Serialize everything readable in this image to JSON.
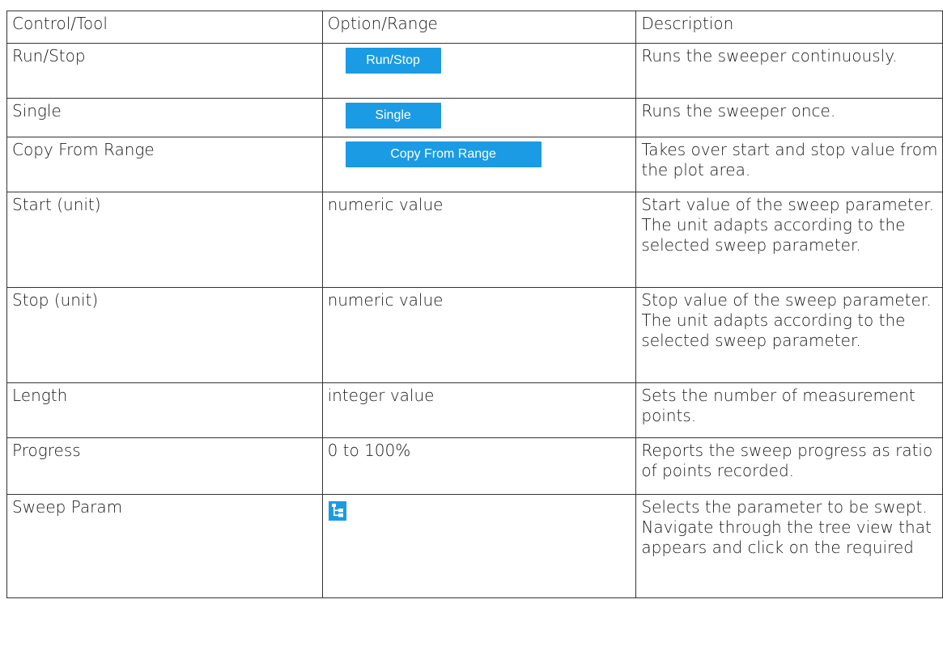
{
  "table": {
    "headers": [
      "Control/Tool",
      "Option/Range",
      "Description"
    ],
    "rows": [
      {
        "control": "Run/Stop",
        "button": "Run/Stop",
        "description": "Runs the sweeper continuously."
      },
      {
        "control": "Single",
        "button": "Single",
        "description": "Runs the sweeper once."
      },
      {
        "control": "Copy From Range",
        "button": "Copy From Range",
        "description": "Takes over start and stop value from the plot area."
      },
      {
        "control": "Start (unit)",
        "option": "numeric value",
        "description": "Start value of the sweep parameter. The unit adapts according to the selected sweep parameter."
      },
      {
        "control": "Stop (unit)",
        "option": "numeric value",
        "description": "Stop value of the sweep parameter. The unit adapts according to the selected sweep parameter."
      },
      {
        "control": "Length",
        "option": "integer value",
        "description": "Sets the number of measurement points."
      },
      {
        "control": "Progress",
        "option": "0 to 100%",
        "description": "Reports the sweep progress as ratio of points recorded."
      },
      {
        "control": "Sweep Param",
        "icon": "tree-view-icon",
        "description": "Selects the parameter to be swept. Navigate through the tree view that appears and click on the required"
      }
    ]
  },
  "colors": {
    "accent": "#1b9be3",
    "border": "#333333",
    "text": "#1a1a1a"
  }
}
